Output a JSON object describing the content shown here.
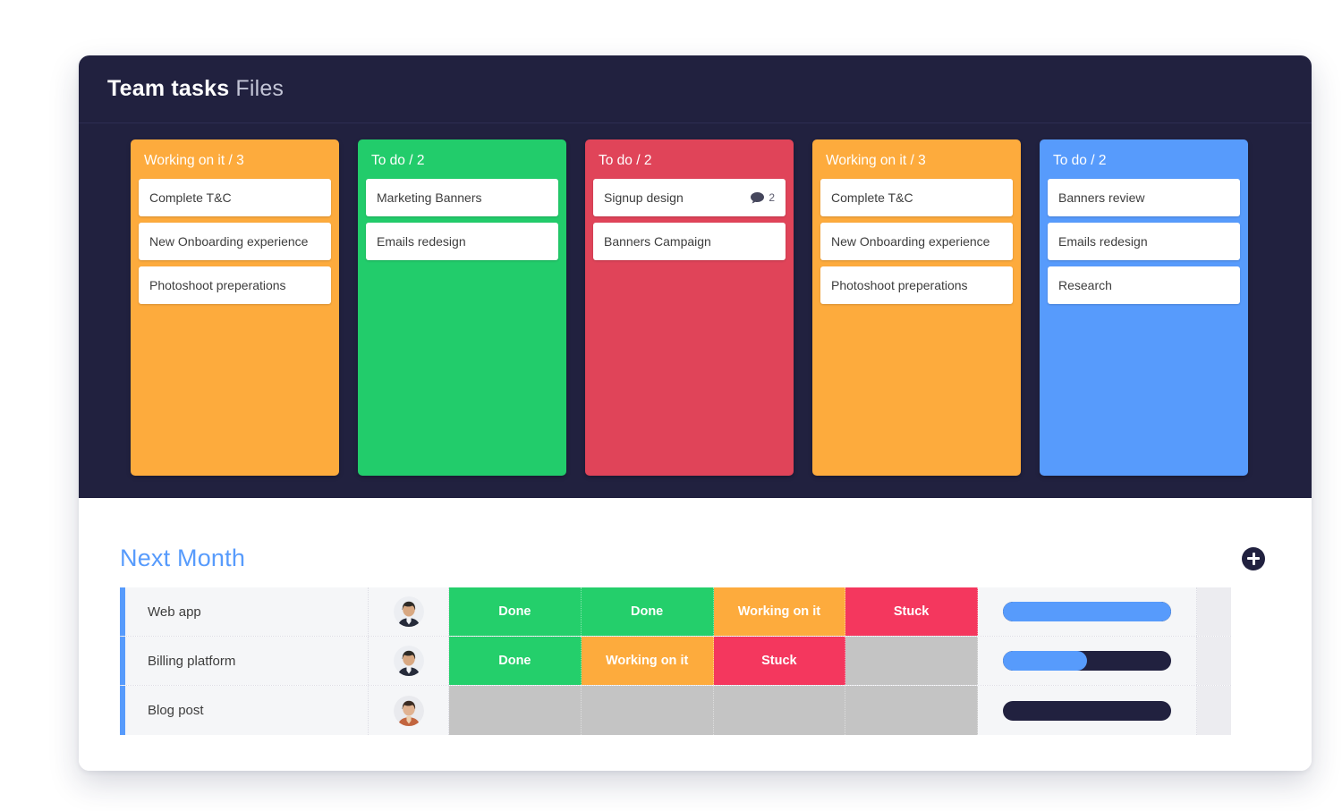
{
  "board": {
    "title_strong": "Team tasks",
    "title_light": "Files",
    "columns": [
      {
        "title": "Working on it / 3",
        "color": "#FDAB3D",
        "cards": [
          {
            "label": "Complete T&C"
          },
          {
            "label": "New Onboarding experience"
          },
          {
            "label": "Photoshoot preperations"
          }
        ]
      },
      {
        "title": "To do / 2",
        "color": "#22CC6B",
        "cards": [
          {
            "label": "Marketing Banners"
          },
          {
            "label": "Emails redesign"
          }
        ]
      },
      {
        "title": "To do / 2",
        "color": "#E04459",
        "cards": [
          {
            "label": "Signup design",
            "comments": "2",
            "comment_icon": "comment-bubble-icon"
          },
          {
            "label": "Banners Campaign"
          }
        ]
      },
      {
        "title": "Working on it / 3",
        "color": "#FDAB3D",
        "cards": [
          {
            "label": "Complete T&C"
          },
          {
            "label": "New Onboarding experience"
          },
          {
            "label": "Photoshoot preperations"
          }
        ]
      },
      {
        "title": "To do / 2",
        "color": "#579BFC",
        "cards": [
          {
            "label": "Banners review"
          },
          {
            "label": "Emails redesign"
          },
          {
            "label": "Research"
          }
        ]
      }
    ]
  },
  "table": {
    "title": "Next Month",
    "add_button_icon": "plus-circle-icon",
    "accent_color": "#579BFC",
    "status_colors": {
      "done": "#24CF6B",
      "working": "#FDAB3D",
      "stuck": "#F4375E",
      "empty": "#C4C4C4"
    },
    "rows": [
      {
        "name": "Web app",
        "avatar": "avatar-man-1",
        "statuses": [
          {
            "label": "Done",
            "state": "done"
          },
          {
            "label": "Done",
            "state": "done"
          },
          {
            "label": "Working on it",
            "state": "working"
          },
          {
            "label": "Stuck",
            "state": "stuck"
          }
        ],
        "progress": 100
      },
      {
        "name": "Billing platform",
        "avatar": "avatar-man-2",
        "statuses": [
          {
            "label": "Done",
            "state": "done"
          },
          {
            "label": "Working on it",
            "state": "working"
          },
          {
            "label": "Stuck",
            "state": "stuck"
          },
          {
            "label": "",
            "state": "empty"
          }
        ],
        "progress": 50
      },
      {
        "name": "Blog post",
        "avatar": "avatar-woman-1",
        "statuses": [
          {
            "label": "",
            "state": "empty"
          },
          {
            "label": "",
            "state": "empty"
          },
          {
            "label": "",
            "state": "empty"
          },
          {
            "label": "",
            "state": "empty"
          }
        ],
        "progress": 0
      }
    ]
  }
}
